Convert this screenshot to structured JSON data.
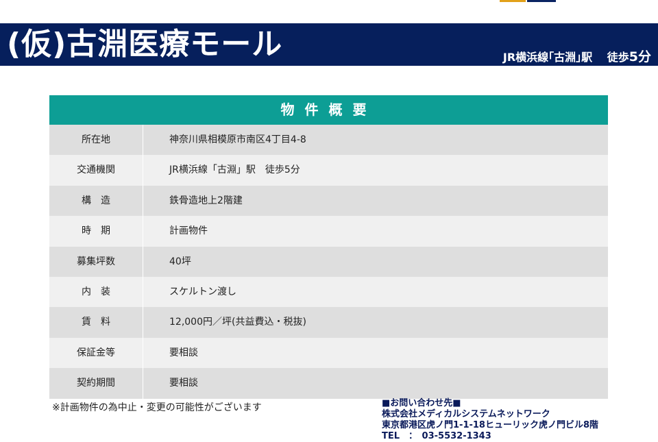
{
  "header": {
    "title": "(仮)古淵医療モール",
    "access_prefix": "JR横浜線｢古淵｣駅　 徒歩",
    "access_minutes": "5分"
  },
  "table": {
    "heading": "物件概要",
    "rows": [
      {
        "label": "所在地",
        "value": "神奈川県相模原市南区4丁目4-8"
      },
      {
        "label": "交通機関",
        "value": "JR横浜線「古淵」駅　徒歩5分"
      },
      {
        "label": "構　造",
        "value": "鉄骨造地上2階建"
      },
      {
        "label": "時　期",
        "value": "計画物件"
      },
      {
        "label": "募集坪数",
        "value": "40坪"
      },
      {
        "label": "内　装",
        "value": "スケルトン渡し"
      },
      {
        "label": "賃　料",
        "value": "12,000円／坪(共益費込・税抜)"
      },
      {
        "label": "保証金等",
        "value": "要相談"
      },
      {
        "label": "契約期間",
        "value": "要相談"
      }
    ]
  },
  "note": "※計画物件の為中止・変更の可能性がございます",
  "contact": {
    "heading": "■お問い合わせ先■",
    "company": "株式会社メディカルシステムネットワーク",
    "address": "東京都港区虎ノ門1-1-18ヒューリック虎ノ門ビル8階",
    "tel": "TEL　：　03-5532-1343"
  },
  "colors": {
    "header_bg": "#061f5c",
    "table_head_bg": "#0d9e95",
    "logo_accent": "#e2a11a"
  }
}
